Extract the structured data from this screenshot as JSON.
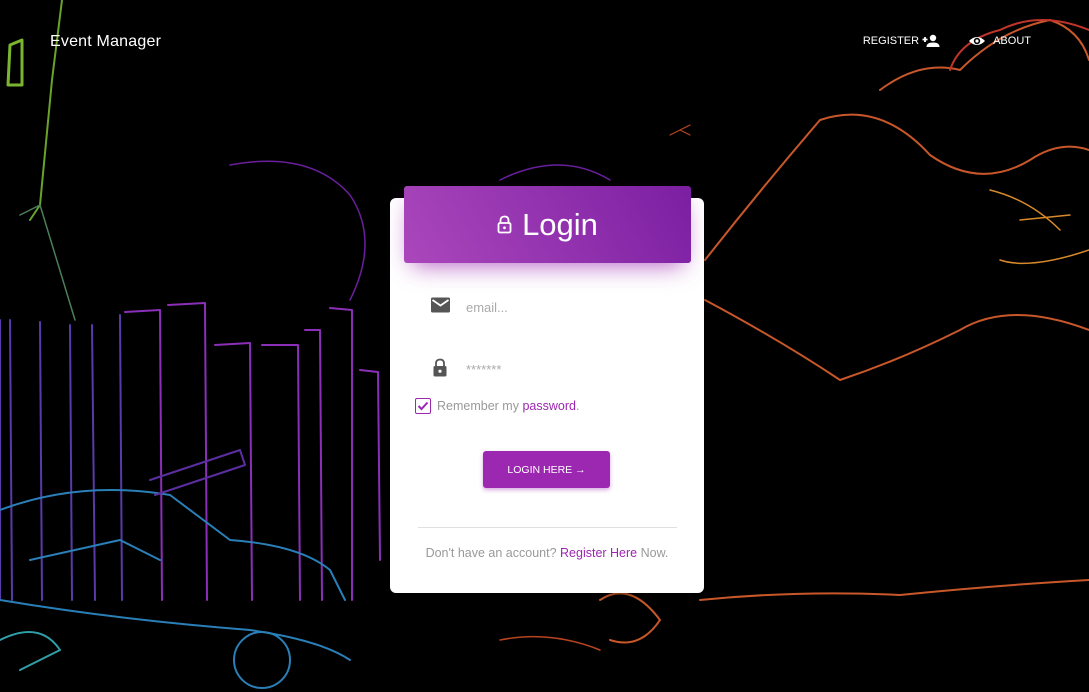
{
  "navbar": {
    "brand": "Event Manager",
    "links": [
      {
        "label": "REGISTER",
        "icon": "person-add-icon"
      },
      {
        "label": "ABOUT",
        "icon": "eye-icon"
      }
    ]
  },
  "login_card": {
    "title": "Login",
    "title_icon": "lock-icon",
    "email": {
      "placeholder": "email...",
      "value": "",
      "icon": "mail-icon"
    },
    "password": {
      "placeholder": "*******",
      "value": "",
      "icon": "lock-icon"
    },
    "remember": {
      "text_before": "Remember my ",
      "link": "password",
      "text_after": ".",
      "checked": true
    },
    "submit_label": "LOGIN HERE →",
    "footer": {
      "text_before": "Don't have an account? ",
      "link": "Register Here",
      "text_after": " Now."
    }
  },
  "colors": {
    "accent": "#9c27b0",
    "header_gradient_start": "#ab47bc",
    "header_gradient_end": "#7b1fa2",
    "background": "#000000"
  }
}
